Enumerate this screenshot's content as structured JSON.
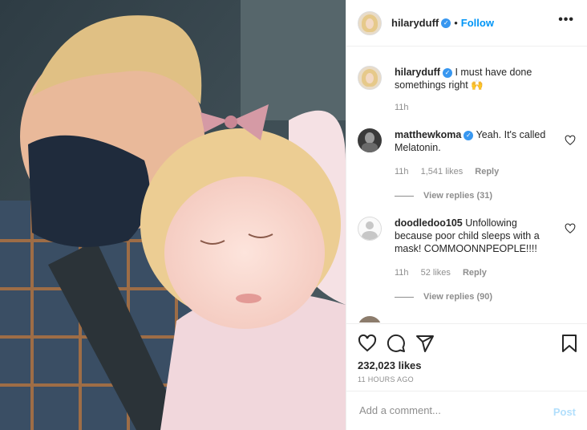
{
  "post": {
    "username": "hilaryduff",
    "separator": "•",
    "follow_label": "Follow",
    "more_label": "•••"
  },
  "caption": {
    "username": "hilaryduff",
    "text": "I must have done somethings right",
    "emoji": "🙌",
    "time": "11h"
  },
  "comments": [
    {
      "username": "matthewkoma",
      "verified": true,
      "text": "Yeah. It's called Melatonin.",
      "time": "11h",
      "likes": "1,541 likes",
      "reply": "Reply",
      "view_replies": "View replies (31)"
    },
    {
      "username": "doodledoo105",
      "verified": false,
      "text": "Unfollowing because poor child sleeps with a mask! COMMOONNPEOPLE!!!!",
      "time": "11h",
      "likes": "52 likes",
      "reply": "Reply",
      "view_replies": "View replies (90)"
    }
  ],
  "footer": {
    "likes": "232,023 likes",
    "time_ago": "11 HOURS AGO",
    "comment_placeholder": "Add a comment...",
    "post_label": "Post"
  },
  "icons": {
    "like": "heart-icon",
    "comment": "comment-icon",
    "share": "share-icon",
    "save": "bookmark-icon",
    "verified": "verified-badge-icon"
  },
  "colors": {
    "accent": "#0095f6",
    "verified": "#3897f0",
    "muted": "#8e8e8e",
    "post_disabled": "#b2dffc"
  }
}
